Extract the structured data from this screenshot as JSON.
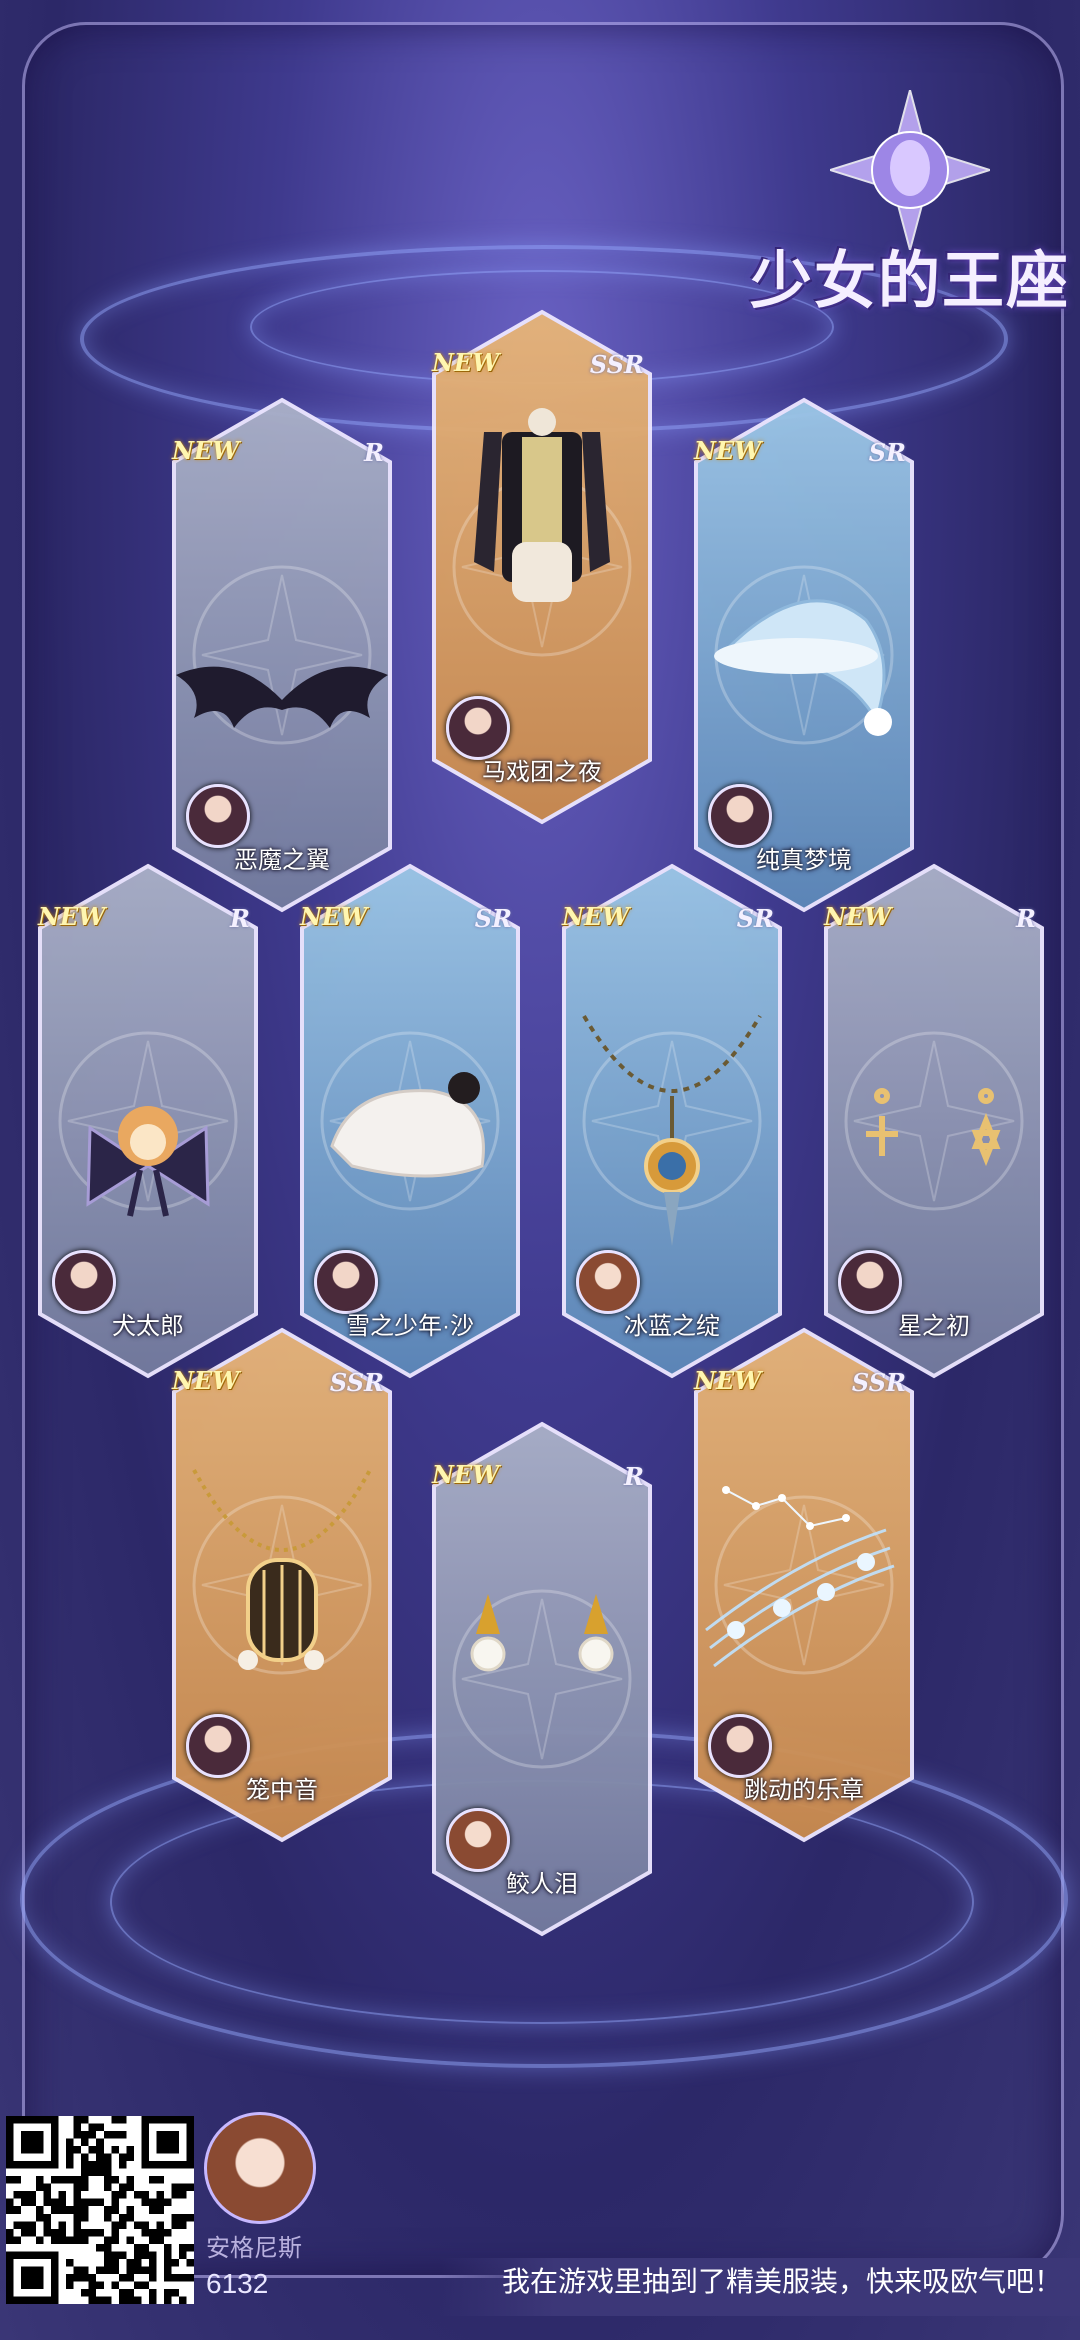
{
  "game": {
    "logo_text": "少女的王座"
  },
  "cards": [
    {
      "name": "马戏团之夜",
      "rarity": "SSR",
      "new_label": "NEW",
      "tier": "gold",
      "item": "circus-outfit",
      "avatar": "dark"
    },
    {
      "name": "恶魔之翼",
      "rarity": "R",
      "new_label": "NEW",
      "tier": "gray",
      "item": "devil-wings",
      "avatar": "dark"
    },
    {
      "name": "纯真梦境",
      "rarity": "SR",
      "new_label": "NEW",
      "tier": "blue",
      "item": "night-cap",
      "avatar": "dark"
    },
    {
      "name": "犬太郎",
      "rarity": "R",
      "new_label": "NEW",
      "tier": "gray",
      "item": "dog-bow",
      "avatar": "dark"
    },
    {
      "name": "雪之少年·沙",
      "rarity": "SR",
      "new_label": "NEW",
      "tier": "blue",
      "item": "beret",
      "avatar": "dark"
    },
    {
      "name": "冰蓝之绽",
      "rarity": "SR",
      "new_label": "NEW",
      "tier": "blue",
      "item": "pendant-necklace",
      "avatar": "brown"
    },
    {
      "name": "星之初",
      "rarity": "R",
      "new_label": "NEW",
      "tier": "gray",
      "item": "star-earrings",
      "avatar": "dark"
    },
    {
      "name": "笼中音",
      "rarity": "SSR",
      "new_label": "NEW",
      "tier": "gold",
      "item": "cage-necklace",
      "avatar": "dark"
    },
    {
      "name": "鲛人泪",
      "rarity": "R",
      "new_label": "NEW",
      "tier": "gray",
      "item": "pearl-earrings",
      "avatar": "brown"
    },
    {
      "name": "跳动的乐章",
      "rarity": "SSR",
      "new_label": "NEW",
      "tier": "gold",
      "item": "music-notes",
      "avatar": "dark"
    }
  ],
  "footer": {
    "player_name": "安格尼斯",
    "player_score": "6132",
    "share_message": "我在游戏里抽到了精美服装，快来吸欧气吧！"
  },
  "colors": {
    "gold": "#d9a262",
    "blue": "#7fb0d8",
    "gray": "#8a93b4",
    "background": "#3c3775"
  }
}
